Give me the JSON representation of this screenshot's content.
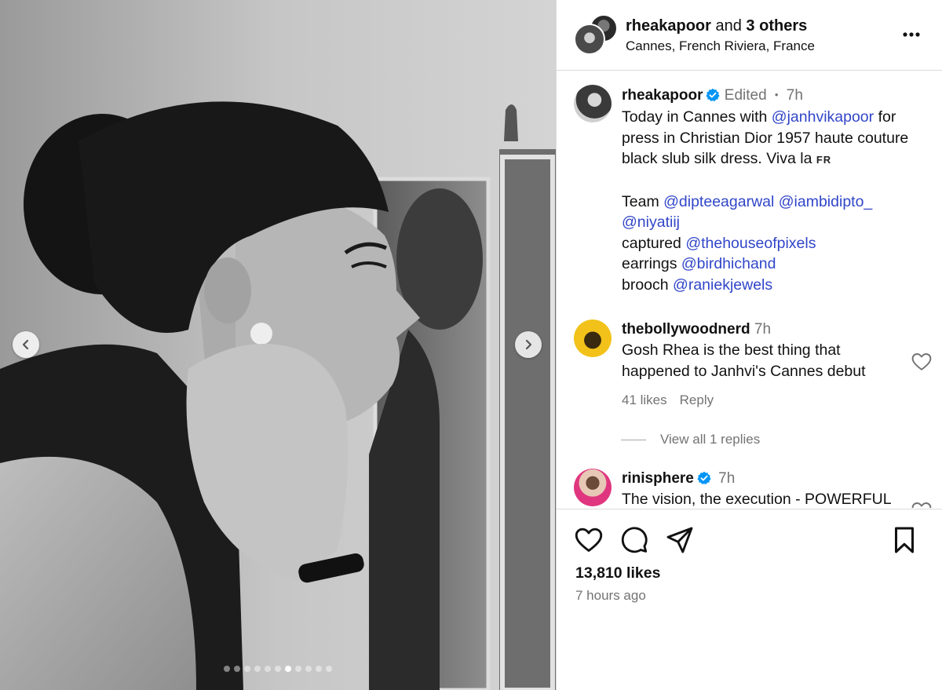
{
  "post": {
    "carousel": {
      "total_slides": 11,
      "active_slide": 7,
      "prev_icon": "chevron-left-icon",
      "next_icon": "chevron-right-icon"
    },
    "header": {
      "author": "rheakapoor",
      "joiner": " and ",
      "others": "3 others",
      "location": "Cannes, French Riviera, France",
      "more_icon": "more-horizontal-icon"
    },
    "caption": {
      "username": "rheakapoor",
      "edited": "Edited",
      "separator": "•",
      "time": "7h",
      "text_a": "Today in Cannes with ",
      "mention_a": "@janhvikapoor",
      "text_b": " for press in Christian Dior 1957 haute couture black slub silk dress. Viva la ",
      "flag": "FR",
      "team_label": "Team ",
      "team_mention_1": "@dipteeagarwal",
      "team_mention_2": "@iambidipto_",
      "team_mention_3": "@niyatiij",
      "captured_label": "captured ",
      "captured_mention": "@thehouseofpixels",
      "earrings_label": "earrings ",
      "earrings_mention": "@birdhichand",
      "brooch_label": "brooch ",
      "brooch_mention": "@raniekjewels"
    },
    "comments": [
      {
        "username": "thebollywoodnerd",
        "time": "7h",
        "text": "Gosh Rhea is the best thing that happened to Janhvi's Cannes debut",
        "likes": "41 likes",
        "reply": "Reply",
        "view_replies": "View all 1 replies"
      },
      {
        "username": "rinisphere",
        "time": "7h",
        "text": "The vision, the execution - POWERFUL"
      }
    ],
    "actions": {
      "like_icon": "heart-icon",
      "comment_icon": "comment-icon",
      "share_icon": "share-icon",
      "save_icon": "bookmark-icon"
    },
    "likes": "13,810 likes",
    "posted": "7 hours ago",
    "colors": {
      "link": "#3146c9",
      "muted": "#737373",
      "verified": "#0095f6",
      "border": "#dbdbdb"
    }
  }
}
